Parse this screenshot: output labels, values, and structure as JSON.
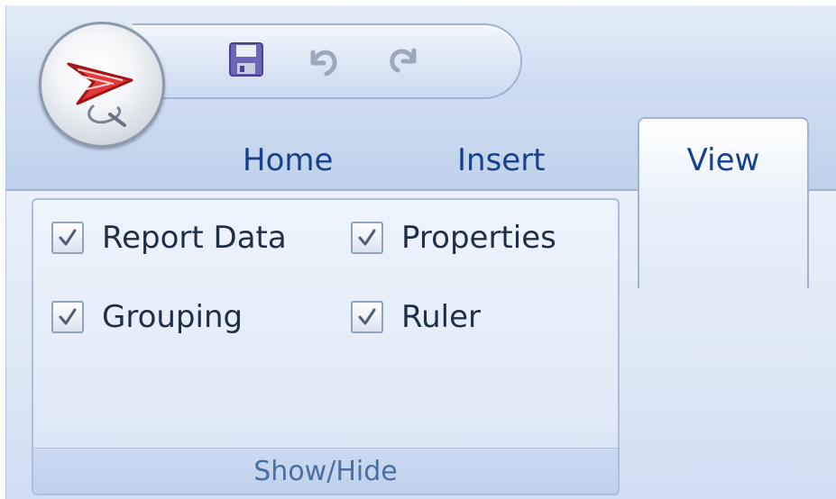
{
  "window": {
    "app_icon": "report-builder-logo",
    "quick_access": [
      {
        "name": "save-icon"
      },
      {
        "name": "undo-icon"
      },
      {
        "name": "redo-icon"
      }
    ]
  },
  "tabs": [
    {
      "label": "Home",
      "active": false
    },
    {
      "label": "Insert",
      "active": false
    },
    {
      "label": "View",
      "active": true
    }
  ],
  "ribbon": {
    "group_label": "Show/Hide",
    "checkboxes": [
      {
        "label": "Report Data",
        "checked": true
      },
      {
        "label": "Properties",
        "checked": true
      },
      {
        "label": "Grouping",
        "checked": true
      },
      {
        "label": "Ruler",
        "checked": true
      }
    ]
  }
}
